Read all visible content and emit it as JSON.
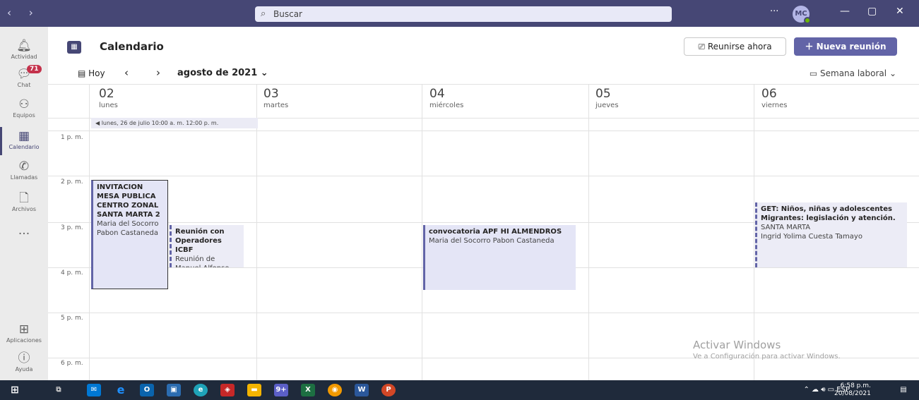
{
  "titlebar": {
    "search_placeholder": "Buscar",
    "more": "···",
    "avatar_initials": "MC"
  },
  "rail": [
    {
      "label": "Actividad",
      "icon": "bell-icon"
    },
    {
      "label": "Chat",
      "icon": "chat-icon",
      "badge": "71"
    },
    {
      "label": "Equipos",
      "icon": "teams-icon"
    },
    {
      "label": "Calendario",
      "icon": "calendar-icon",
      "active": true
    },
    {
      "label": "Llamadas",
      "icon": "phone-icon"
    },
    {
      "label": "Archivos",
      "icon": "file-icon"
    },
    {
      "label": "...",
      "icon": "more-icon"
    },
    {
      "label": "Aplicaciones",
      "icon": "apps-icon"
    },
    {
      "label": "Ayuda",
      "icon": "help-icon"
    }
  ],
  "header": {
    "title": "Calendario",
    "meet_now": "Reunirse ahora",
    "new_meeting": "Nueva reunión"
  },
  "toolbar": {
    "today": "Hoy",
    "month": "agosto de 2021",
    "view": "Semana laboral"
  },
  "days": [
    {
      "num": "02",
      "name": "lunes"
    },
    {
      "num": "03",
      "name": "martes"
    },
    {
      "num": "04",
      "name": "miércoles"
    },
    {
      "num": "05",
      "name": "jueves"
    },
    {
      "num": "06",
      "name": "viernes"
    }
  ],
  "banner": "lunes, 26 de julio 10:00 a. m.   12:00 p. m.",
  "hours": [
    "1 p. m.",
    "2 p. m.",
    "3 p. m.",
    "4 p. m.",
    "5 p. m.",
    "6 p. m."
  ],
  "events": [
    {
      "title": "INVITACION MESA PUBLICA CENTRO ZONAL SANTA MARTA 2",
      "sub": "Maria del Socorro Pabon Castaneda"
    },
    {
      "title": "Reunión con Operadores ICBF",
      "sub": "Reunión de Manuel Alfonso"
    },
    {
      "title": "convocatoria APF HI ALMENDROS",
      "sub": "Maria del Socorro Pabon Castaneda"
    },
    {
      "title": "GET: Niños, niñas y adolescentes Migrantes: legislación y atención.",
      "sub": "SANTA MARTA",
      "sub2": "Ingrid Yolima Cuesta Tamayo"
    }
  ],
  "watermark": {
    "title": "Activar Windows",
    "sub": "Ve a Configuración para activar Windows."
  },
  "taskbar": {
    "lang": "ESP",
    "time": "6:58 p.m.",
    "date": "20/08/2021",
    "teams_badge": "9+"
  }
}
